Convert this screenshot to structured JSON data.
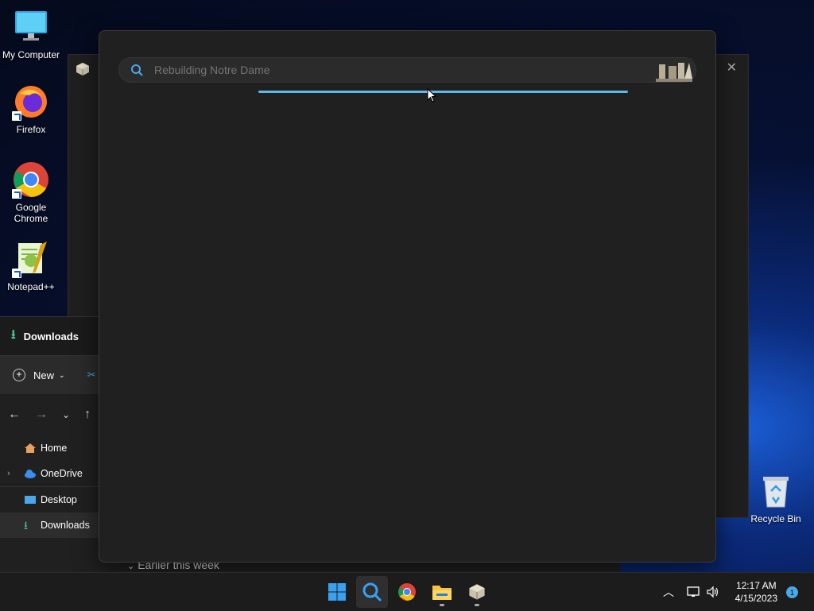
{
  "desktop": {
    "icons": [
      {
        "label": "My Computer"
      },
      {
        "label": "Firefox"
      },
      {
        "label": "Google Chrome"
      },
      {
        "label": "Notepad++"
      }
    ],
    "recycle_bin": "Recycle Bin"
  },
  "explorer": {
    "tab_label": "Downloads",
    "new_label": "New",
    "nav": [
      {
        "label": "Home"
      },
      {
        "label": "OneDrive"
      },
      {
        "label": "Desktop"
      },
      {
        "label": "Downloads"
      }
    ],
    "group_header": "Earlier this week"
  },
  "search": {
    "placeholder": "Rebuilding Notre Dame",
    "progress_visible": true
  },
  "taskbar": {
    "apps": [
      "start-icon",
      "search-icon",
      "chrome-icon",
      "file-explorer-icon",
      "app-cube-icon"
    ],
    "time": "12:17 AM",
    "date": "4/15/2023",
    "notification_count": "1"
  },
  "colors": {
    "accent": "#60b8e8",
    "panel": "#202020"
  }
}
